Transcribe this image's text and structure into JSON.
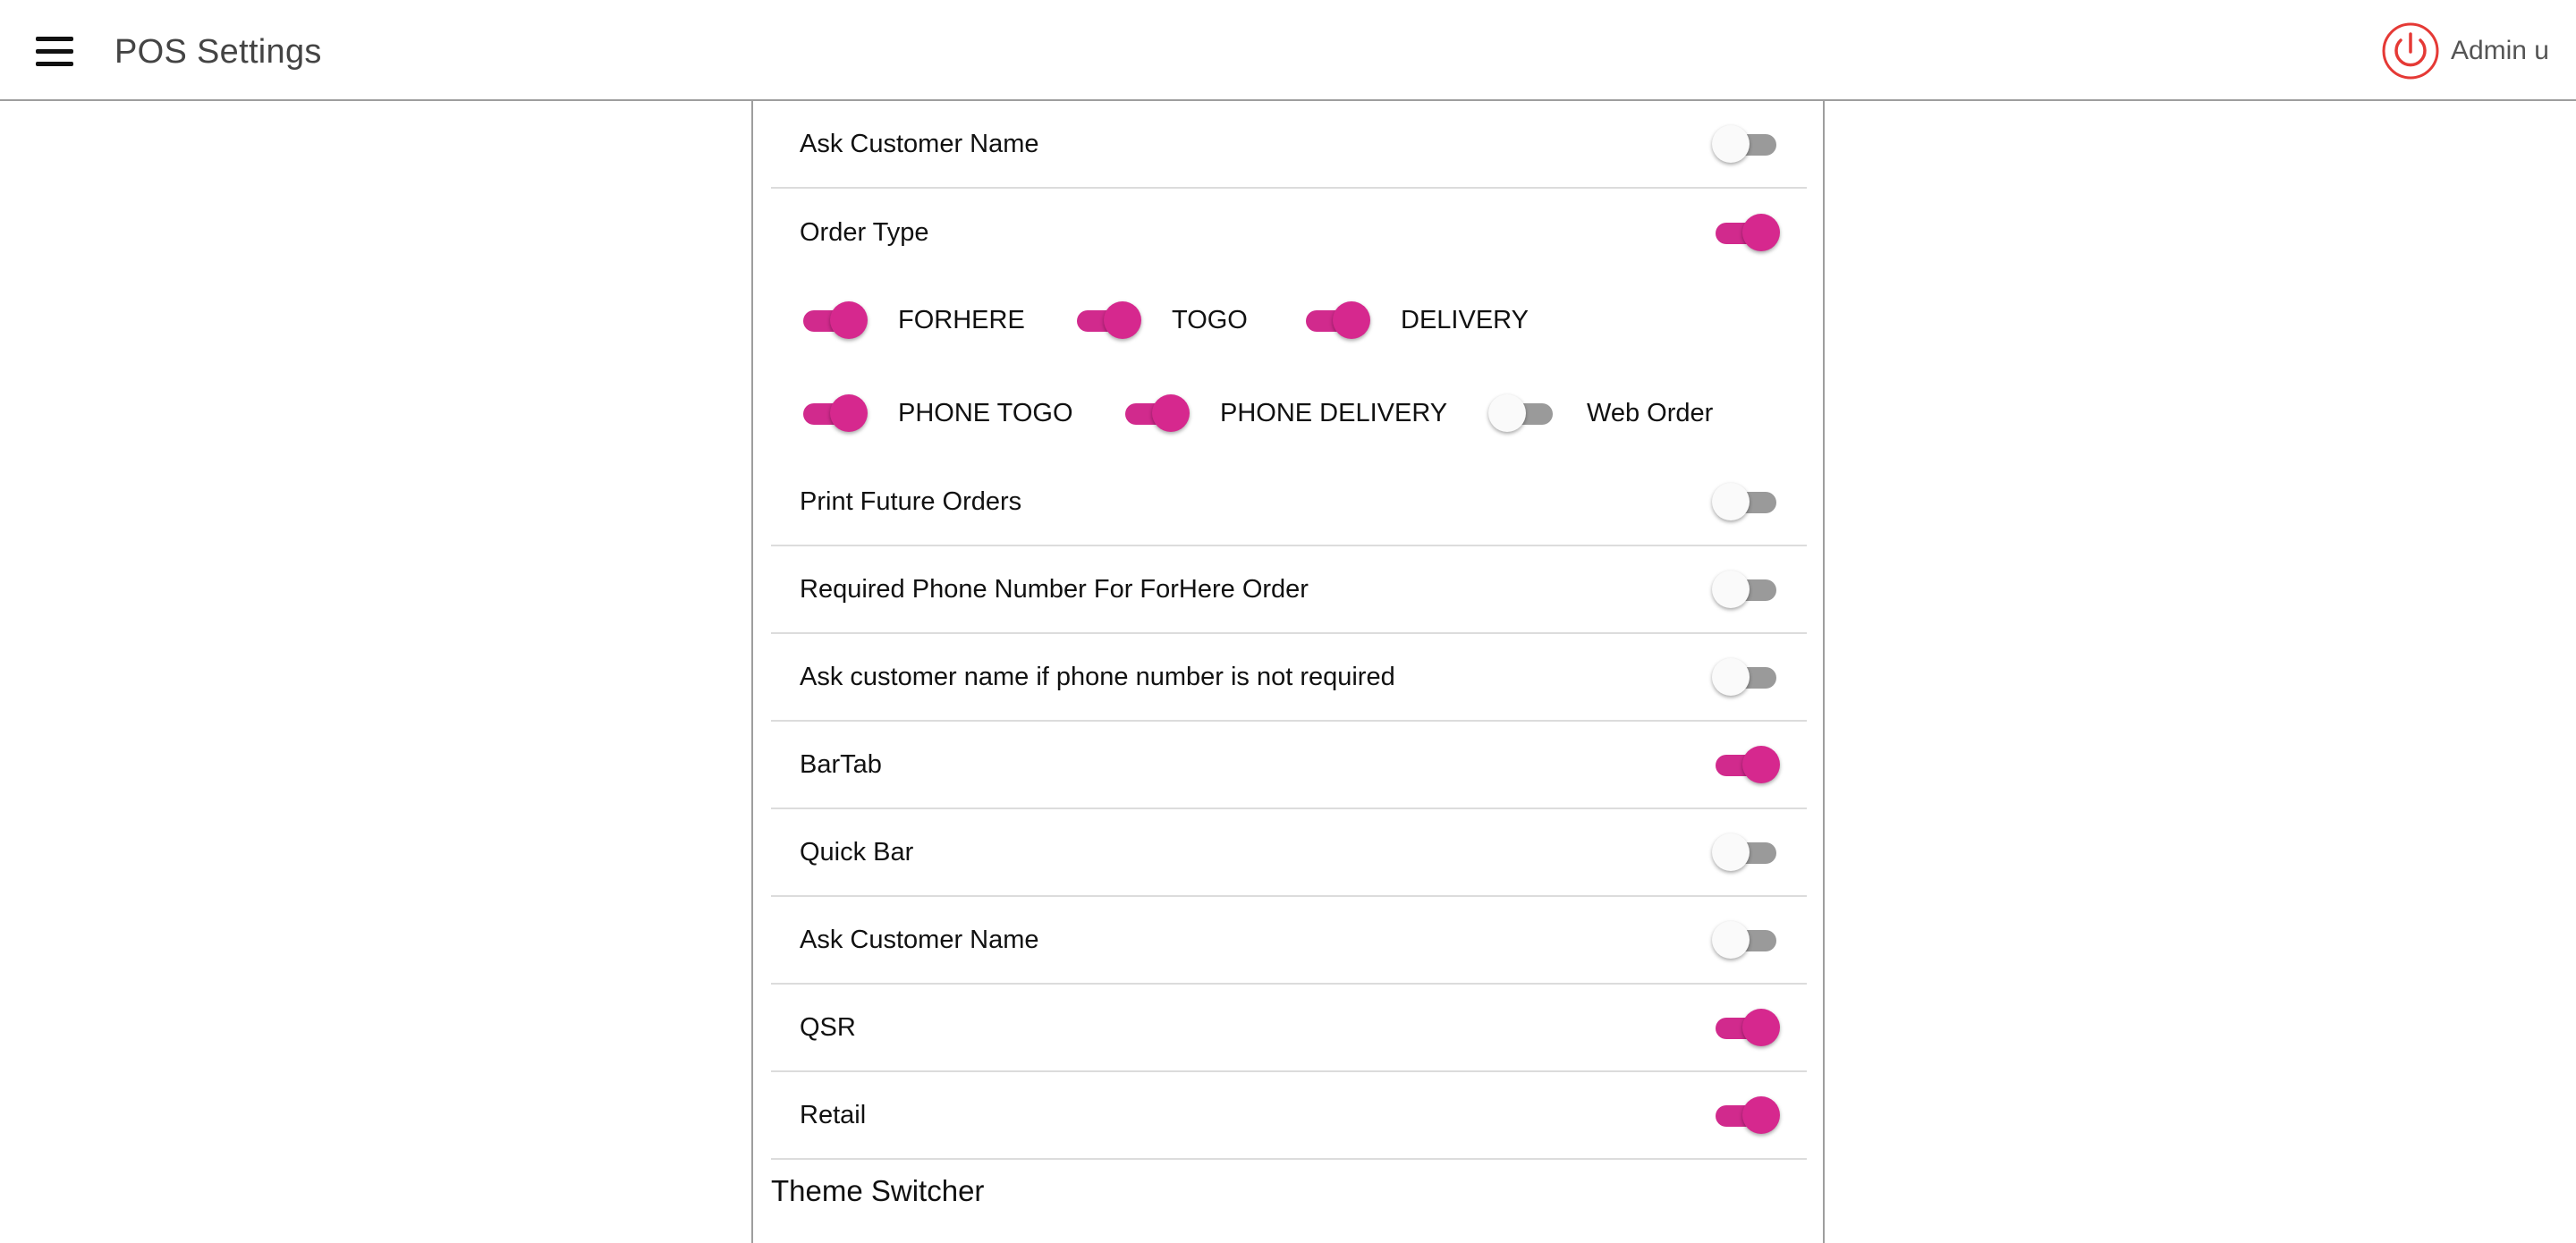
{
  "header": {
    "title": "POS Settings",
    "user_name": "Admin u",
    "menu_icon": "hamburger-menu-icon",
    "power_icon": "power-icon",
    "accent": "#d6288e",
    "power_color": "#e53935"
  },
  "settings": [
    {
      "label": "Ask Customer Name",
      "on": false
    },
    {
      "label": "Order Type",
      "on": true
    },
    {
      "label": "Print Future Orders",
      "on": false
    },
    {
      "label": "Required Phone Number For ForHere Order",
      "on": false
    },
    {
      "label": "Ask customer name if phone number is not required",
      "on": false
    },
    {
      "label": "BarTab",
      "on": true
    },
    {
      "label": "Quick Bar",
      "on": false
    },
    {
      "label": "Ask Customer Name",
      "on": false
    },
    {
      "label": "QSR",
      "on": true
    },
    {
      "label": "Retail",
      "on": true
    }
  ],
  "order_types": [
    {
      "label": "FORHERE",
      "on": true
    },
    {
      "label": "TOGO",
      "on": true
    },
    {
      "label": "DELIVERY",
      "on": true
    },
    {
      "label": "PHONE TOGO",
      "on": true
    },
    {
      "label": "PHONE DELIVERY",
      "on": true
    },
    {
      "label": "Web Order",
      "on": false
    }
  ],
  "theme_section": {
    "title": "Theme Switcher"
  }
}
